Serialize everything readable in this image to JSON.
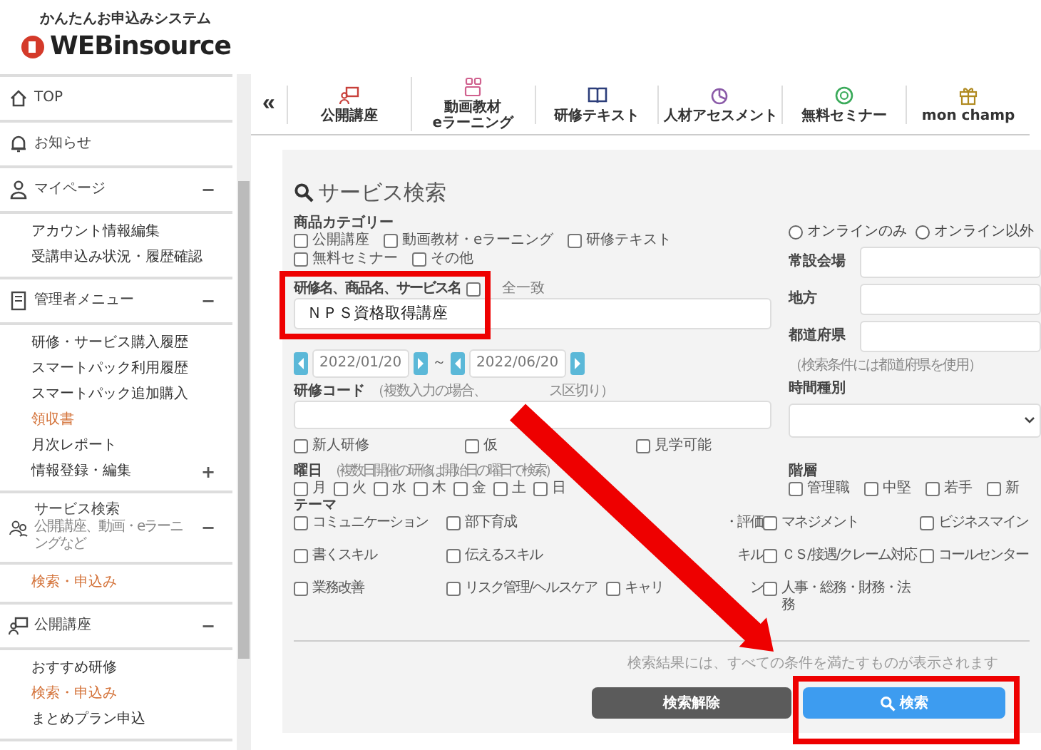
{
  "logo": {
    "tagline": "かんたんお申込みシステム",
    "name": "WEBinsource"
  },
  "sidebar": {
    "sections": [
      {
        "label": "TOP"
      },
      {
        "label": "お知らせ"
      },
      {
        "label": "マイページ",
        "toggle": "−",
        "items": [
          {
            "label": "アカウント情報編集",
            "selected": false
          },
          {
            "label": "受講申込み状況・履歴確認",
            "selected": false
          }
        ]
      },
      {
        "label": "管理者メニュー",
        "toggle": "−",
        "items": [
          {
            "label": "研修・サービス購入履歴",
            "selected": false
          },
          {
            "label": "スマートパック利用履歴",
            "selected": false
          },
          {
            "label": "スマートパック追加購入",
            "selected": false
          },
          {
            "label": "領収書",
            "selected": true
          },
          {
            "label": "月次レポート",
            "selected": false
          },
          {
            "label": "情報登録・編集",
            "selected": false,
            "toggle": "+"
          }
        ]
      },
      {
        "label": "サービス検索",
        "sublabel": "公開講座、動画・eラーニングなど",
        "toggle": "−",
        "items": [
          {
            "label": "検索・申込み",
            "selected": true
          }
        ]
      },
      {
        "label": "公開講座",
        "toggle": "−",
        "items": [
          {
            "label": "おすすめ研修",
            "selected": false
          },
          {
            "label": "検索・申込み",
            "selected": true
          },
          {
            "label": "まとめプラン申込",
            "selected": false
          }
        ]
      }
    ]
  },
  "nav": {
    "collapse": "«",
    "tabs": [
      {
        "label": "公開講座"
      },
      {
        "label": "動画教材\neラーニング"
      },
      {
        "label": "研修テキスト"
      },
      {
        "label": "人材アセスメント"
      },
      {
        "label": "無料セミナー"
      },
      {
        "label": "mon champ"
      }
    ]
  },
  "search": {
    "title": "サービス検索",
    "category": {
      "label": "商品カテゴリー",
      "options": [
        {
          "label": "公開講座",
          "checked": false
        },
        {
          "label": "動画教材・eラーニング",
          "checked": false
        },
        {
          "label": "研修テキスト",
          "checked": false
        },
        {
          "label": "無料セミナー",
          "checked": false
        },
        {
          "label": "その他",
          "checked": false
        }
      ]
    },
    "keyword": {
      "label": "研修名、商品名、サービス名",
      "exact": {
        "label": "全一致",
        "checked": false
      },
      "value": "ＮＰＳ資格取得講座"
    },
    "dates": {
      "from": "2022/01/20",
      "separator": "～",
      "to": "2022/06/20"
    },
    "code": {
      "label": "研修コード",
      "hint": "（複数入力の場合、",
      "hint_tail": "ス区切り）"
    },
    "flags": [
      {
        "label": "新人研修",
        "checked": false
      },
      {
        "label": "仮",
        "checked": false
      },
      {
        "label": "見学可能",
        "checked": false
      }
    ],
    "weekdays": {
      "label": "曜日",
      "hint": "（複数日開催の研修は開始日の曜日で検索）",
      "days": [
        {
          "label": "月",
          "checked": false
        },
        {
          "label": "火",
          "checked": false
        },
        {
          "label": "水",
          "checked": false
        },
        {
          "label": "木",
          "checked": false
        },
        {
          "label": "金",
          "checked": false
        },
        {
          "label": "土",
          "checked": false
        },
        {
          "label": "日",
          "checked": false
        }
      ]
    },
    "online": [
      {
        "label": "オンラインのみ",
        "selected": false
      },
      {
        "label": "オンライン以外",
        "selected": false
      }
    ],
    "location_fields": [
      {
        "label": "常設会場"
      },
      {
        "label": "地方"
      },
      {
        "label": "都道府県"
      }
    ],
    "location_note": "（検索条件には都道府県を使用）",
    "time_type": {
      "label": "時間種別"
    },
    "levels": {
      "label": "階層",
      "options": [
        {
          "label": "管理職",
          "checked": false
        },
        {
          "label": "中堅",
          "checked": false
        },
        {
          "label": "若手",
          "checked": false
        },
        {
          "label": "新",
          "checked": false
        }
      ]
    },
    "themes": {
      "label": "テーマ",
      "options": [
        {
          "kind": "checkbox",
          "label": "コミュニケーション",
          "checked": false
        },
        {
          "kind": "checkbox",
          "label": "部下育成",
          "checked": false
        },
        {
          "kind": "covered",
          "label": "・評価"
        },
        {
          "kind": "checkbox",
          "label": "マネジメント",
          "checked": false
        },
        {
          "kind": "checkbox",
          "label": "ビジネスマイン",
          "checked": false
        },
        {
          "kind": "checkbox",
          "label": "書くスキル",
          "checked": false
        },
        {
          "kind": "checkbox",
          "label": "伝えるスキル",
          "checked": false
        },
        {
          "kind": "covered",
          "label": "キル"
        },
        {
          "kind": "checkbox",
          "label": "ＣＳ/接遇/クレーム対応",
          "checked": false
        },
        {
          "kind": "checkbox",
          "label": "コールセンター",
          "checked": false
        },
        {
          "kind": "checkbox",
          "label": "業務改善",
          "checked": false
        },
        {
          "kind": "checkbox",
          "label": "リスク管理/ヘルスケア",
          "checked": false
        },
        {
          "kind": "checkbox",
          "label": "キャリ",
          "tail": "ン",
          "checked": false
        },
        {
          "kind": "checkbox",
          "label": "人事・総務・財務・法務",
          "checked": false
        }
      ]
    },
    "note": "検索結果には、すべての条件を満たすものが表示されます",
    "buttons": [
      {
        "kind": "reset",
        "label": "検索解除"
      },
      {
        "kind": "search",
        "label": "検索"
      }
    ]
  }
}
